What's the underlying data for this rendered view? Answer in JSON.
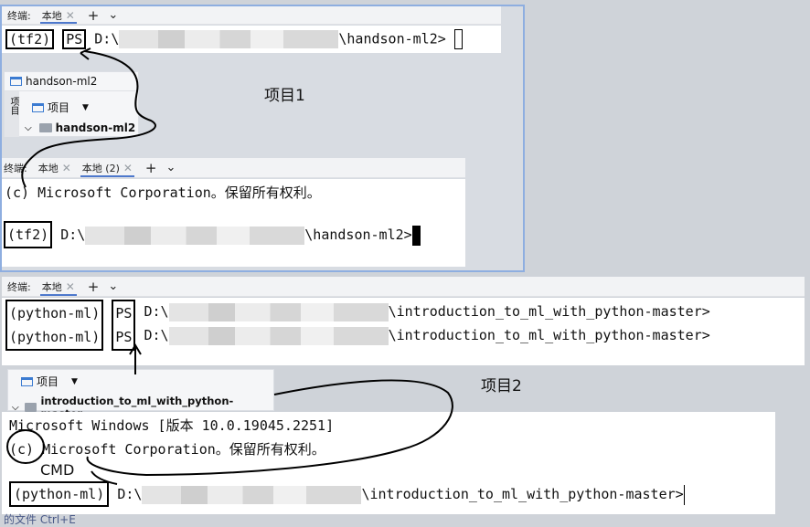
{
  "tabbar1": {
    "terminal_label": "终端:",
    "tab_local": "本地",
    "add": "+",
    "chevron": "⌄"
  },
  "term1": {
    "env": "(tf2)",
    "ps": "PS",
    "path_prefix": "D:\\",
    "path_suffix": "\\handson-ml2>"
  },
  "project_window": {
    "title": "handson-ml2",
    "view_label": "项目",
    "side_label": "项目",
    "root_folder": "handson-ml2"
  },
  "label_project1": "项目1",
  "tabbar2": {
    "terminal_label": "终端:",
    "tab_local": "本地",
    "tab_local2": "本地 (2)",
    "add": "+",
    "chevron": "⌄"
  },
  "term2": {
    "copyright": "(c) Microsoft Corporation。保留所有权利。",
    "env": "(tf2)",
    "path_prefix": "D:\\",
    "path_suffix": "\\handson-ml2>"
  },
  "tabbar3": {
    "terminal_label": "终端:",
    "tab_local": "本地",
    "add": "+",
    "chevron": "⌄"
  },
  "term3": {
    "line1_env": "(python-ml)",
    "line1_ps": "PS",
    "line1_prefix": "D:\\",
    "line1_suffix": "\\introduction_to_ml_with_python-master>",
    "line2_env": "(python-ml)",
    "line2_ps": "PS",
    "line2_prefix": "D:\\",
    "line2_suffix": "\\introduction_to_ml_with_python-master>"
  },
  "project2": {
    "view_label": "项目",
    "root_folder": "introduction_to_ml_with_python-master"
  },
  "label_project2": "项目2",
  "term4": {
    "windows_line": "Microsoft Windows [版本 10.0.19045.2251]",
    "c_mark": "(c)",
    "copyright_rest": "Microsoft Corporation。保留所有权利。",
    "env": "(python-ml)",
    "path_prefix": "D:\\",
    "path_suffix": "\\introduction_to_ml_with_python-master>"
  },
  "label_cmd": "CMD",
  "footer_hint": "的文件 Ctrl+E"
}
